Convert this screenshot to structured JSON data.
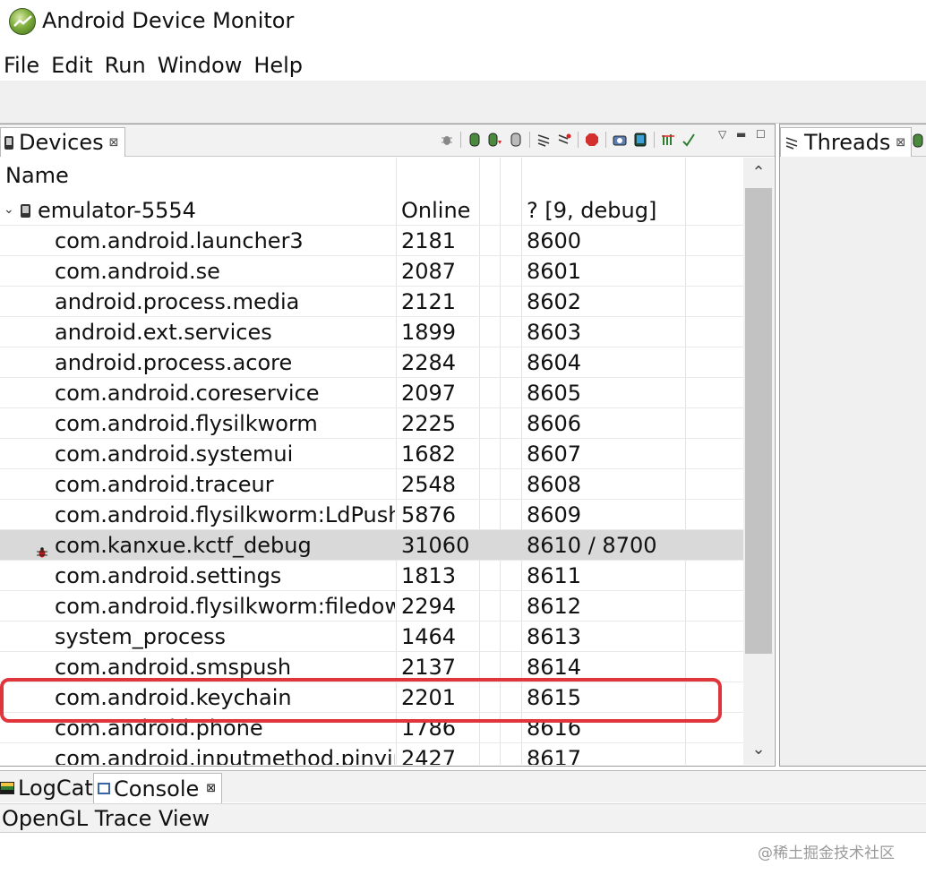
{
  "app": {
    "title": "Android Device Monitor"
  },
  "menu": [
    "File",
    "Edit",
    "Run",
    "Window",
    "Help"
  ],
  "devices_tab": {
    "label": "Devices",
    "close": "⊠"
  },
  "threads_tab": {
    "label": "Threads",
    "close": "⊠"
  },
  "tree": {
    "column_header": "Name",
    "device": {
      "name": "emulator-5554",
      "status": "Online",
      "target": "? [9, debug]"
    },
    "processes": [
      {
        "name": "com.android.launcher3",
        "pid": "2181",
        "port": "8600"
      },
      {
        "name": "com.android.se",
        "pid": "2087",
        "port": "8601"
      },
      {
        "name": "android.process.media",
        "pid": "2121",
        "port": "8602"
      },
      {
        "name": "android.ext.services",
        "pid": "1899",
        "port": "8603"
      },
      {
        "name": "android.process.acore",
        "pid": "2284",
        "port": "8604"
      },
      {
        "name": "com.android.coreservice",
        "pid": "2097",
        "port": "8605"
      },
      {
        "name": "com.android.flysilkworm",
        "pid": "2225",
        "port": "8606"
      },
      {
        "name": "com.android.systemui",
        "pid": "1682",
        "port": "8607"
      },
      {
        "name": "com.android.traceur",
        "pid": "2548",
        "port": "8608"
      },
      {
        "name": "com.android.flysilkworm:LdPushS",
        "pid": "5876",
        "port": "8609"
      },
      {
        "name": "com.kanxue.kctf_debug",
        "pid": "31060",
        "port": "8610 / 8700",
        "selected": true,
        "debug": true
      },
      {
        "name": "com.android.settings",
        "pid": "1813",
        "port": "8611"
      },
      {
        "name": "com.android.flysilkworm:filedown",
        "pid": "2294",
        "port": "8612"
      },
      {
        "name": "system_process",
        "pid": "1464",
        "port": "8613"
      },
      {
        "name": "com.android.smspush",
        "pid": "2137",
        "port": "8614"
      },
      {
        "name": "com.android.keychain",
        "pid": "2201",
        "port": "8615"
      },
      {
        "name": "com.android.phone",
        "pid": "1786",
        "port": "8616"
      },
      {
        "name": "com.android.inputmethod.pinyin",
        "pid": "2427",
        "port": "8617"
      }
    ]
  },
  "bottom": {
    "logcat": "LogCat",
    "console": "Console",
    "console_close": "⊠",
    "opengl": "OpenGL Trace View"
  },
  "watermark": "@稀土掘金技术社区",
  "colors": {
    "highlight": "#e0363b",
    "selected_row": "#d9d9d9"
  }
}
